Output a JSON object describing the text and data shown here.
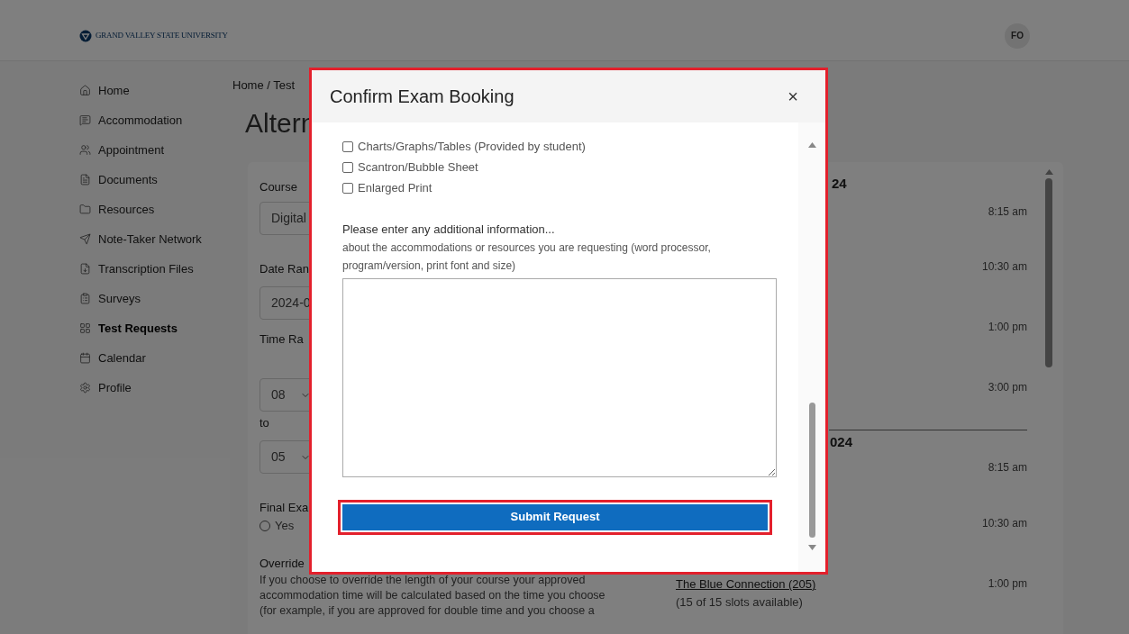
{
  "header": {
    "logo": "GRAND VALLEY STATE UNIVERSITY",
    "avatar": "FO"
  },
  "sidebar": {
    "items": [
      {
        "label": "Home",
        "selected": false
      },
      {
        "label": "Accommodation",
        "selected": false
      },
      {
        "label": "Appointment",
        "selected": false
      },
      {
        "label": "Documents",
        "selected": false
      },
      {
        "label": "Resources",
        "selected": false
      },
      {
        "label": "Note-Taker Network",
        "selected": false
      },
      {
        "label": "Transcription Files",
        "selected": false
      },
      {
        "label": "Surveys",
        "selected": false
      },
      {
        "label": "Test Requests",
        "selected": true
      },
      {
        "label": "Calendar",
        "selected": false
      },
      {
        "label": "Profile",
        "selected": false
      }
    ]
  },
  "breadcrumb": "Home / Test",
  "page_title": "Altern",
  "form": {
    "course_label": "Course",
    "course_value": "Digital",
    "date_label": "Date Ran",
    "date_value": "2024-0",
    "time_label": "Time Ra",
    "time_from": "08",
    "to_label": "to",
    "time_to": "05",
    "final_label": "Final Exa",
    "final_options": [
      {
        "label": "Yes",
        "selected": false
      }
    ],
    "override_label": "Override",
    "override_text": [
      "If you choose to override the length of your course your approved",
      "accommodation time will be calculated based on the time you choose",
      "(for example, if you are approved for double time and you choose a"
    ]
  },
  "slots": {
    "days": [
      {
        "date": "24",
        "times": [
          "8:15 am",
          "10:30 am",
          "1:00 pm",
          "3:00 pm"
        ]
      },
      {
        "date": "024",
        "times": [
          "8:15 am",
          "10:30 am",
          "1:00 pm"
        ],
        "location": "The Blue Connection (205)",
        "availability": "(15 of 15 slots available)"
      }
    ]
  },
  "modal": {
    "title": "Confirm Exam Booking",
    "close": "×",
    "checkboxes": [
      {
        "label": "Charts/Graphs/Tables (Provided by student)",
        "checked": false
      },
      {
        "label": "Scantron/Bubble Sheet",
        "checked": false
      },
      {
        "label": "Enlarged Print",
        "checked": false
      }
    ],
    "info_label": "Please enter any additional information...",
    "info_hint": "about the accommodations or resources you are requesting (word processor, program/version, print font and size)",
    "submit": "Submit Request"
  }
}
